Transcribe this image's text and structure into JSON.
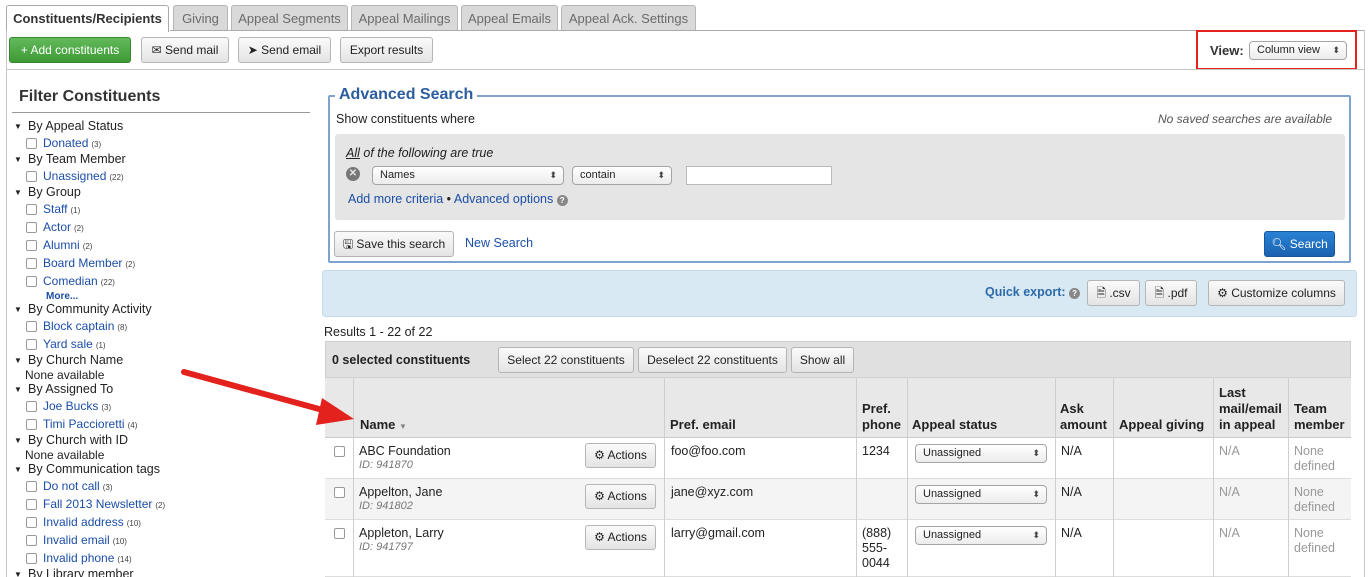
{
  "tabs": [
    {
      "label": "Constituents/Recipients",
      "active": true
    },
    {
      "label": "Giving"
    },
    {
      "label": "Appeal Segments"
    },
    {
      "label": "Appeal Mailings"
    },
    {
      "label": "Appeal Emails"
    },
    {
      "label": "Appeal Ack. Settings"
    }
  ],
  "toolbar": {
    "add": "+ Add constituents",
    "send_mail": "Send mail",
    "send_email": "Send email",
    "export": "Export results",
    "view_label": "View:",
    "view_value": "Column view"
  },
  "filter": {
    "title": "Filter Constituents",
    "groups": [
      {
        "label": "By Appeal Status",
        "items": [
          {
            "label": "Donated",
            "count": "(3)"
          }
        ]
      },
      {
        "label": "By Team Member",
        "items": [
          {
            "label": "Unassigned",
            "count": "(22)"
          }
        ]
      },
      {
        "label": "By Group",
        "items": [
          {
            "label": "Staff",
            "count": "(1)"
          },
          {
            "label": "Actor",
            "count": "(2)"
          },
          {
            "label": "Alumni",
            "count": "(2)"
          },
          {
            "label": "Board Member",
            "count": "(2)"
          },
          {
            "label": "Comedian",
            "count": "(22)"
          }
        ],
        "more": "More..."
      },
      {
        "label": "By Community Activity",
        "items": [
          {
            "label": "Block captain",
            "count": "(8)"
          },
          {
            "label": "Yard sale",
            "count": "(1)"
          }
        ]
      },
      {
        "label": "By Church Name",
        "none": "None available"
      },
      {
        "label": "By Assigned To",
        "items": [
          {
            "label": "Joe Bucks",
            "count": "(3)"
          },
          {
            "label": "Timi Paccioretti",
            "count": "(4)"
          }
        ]
      },
      {
        "label": "By Church with ID",
        "none": "None available"
      },
      {
        "label": "By Communication tags",
        "items": [
          {
            "label": "Do not call",
            "count": "(3)"
          },
          {
            "label": "Fall 2013 Newsletter",
            "count": "(2)"
          },
          {
            "label": "Invalid address",
            "count": "(10)"
          },
          {
            "label": "Invalid email",
            "count": "(10)"
          },
          {
            "label": "Invalid phone",
            "count": "(14)"
          }
        ]
      },
      {
        "label": "By Library member"
      }
    ]
  },
  "advanced": {
    "title": "Advanced Search",
    "show_where": "Show constituents where",
    "no_saved": "No saved searches are available",
    "all_prefix": "All",
    "all_suffix": " of the following are true",
    "field": "Names",
    "operator": "contain",
    "add_more": "Add more criteria",
    "dot": "•",
    "advanced_options": "Advanced options",
    "save_search": "Save this search",
    "new_search": "New Search",
    "search": "Search"
  },
  "quick_export": {
    "label": "Quick export:",
    "csv": ".csv",
    "pdf": ".pdf",
    "customize": "Customize columns"
  },
  "results": {
    "summary": "Results 1 - 22 of 22",
    "selected": "0 selected constituents",
    "select_all": "Select 22 constituents",
    "deselect_all": "Deselect 22 constituents",
    "show_all": "Show all"
  },
  "columns": {
    "name": "Name",
    "email": "Pref. email",
    "phone": "Pref. phone",
    "status": "Appeal status",
    "ask": "Ask amount",
    "giving": "Appeal giving",
    "last_mail": "Last mail/email in appeal",
    "team": "Team member"
  },
  "rows": [
    {
      "name": "ABC Foundation",
      "id": "ID: 941870",
      "email": "foo@foo.com",
      "phone": "1234",
      "status": "Unassigned",
      "ask": "N/A",
      "giving": "",
      "last": "N/A",
      "team": "None defined",
      "actions": "Actions"
    },
    {
      "name": "Appelton, Jane",
      "id": "ID: 941802",
      "email": "jane@xyz.com",
      "phone": "",
      "status": "Unassigned",
      "ask": "N/A",
      "giving": "",
      "last": "N/A",
      "team": "None defined",
      "actions": "Actions"
    },
    {
      "name": "Appleton, Larry",
      "id": "ID: 941797",
      "email": "larry@gmail.com",
      "phone": "(888) 555-0044",
      "status": "Unassigned",
      "ask": "N/A",
      "giving": "",
      "last": "N/A",
      "team": "None defined",
      "actions": "Actions"
    }
  ],
  "colors": {
    "accent": "#1b4ea8",
    "highlight": "#e3221d",
    "green": "#3d9a35",
    "blue": "#1a62b0"
  }
}
